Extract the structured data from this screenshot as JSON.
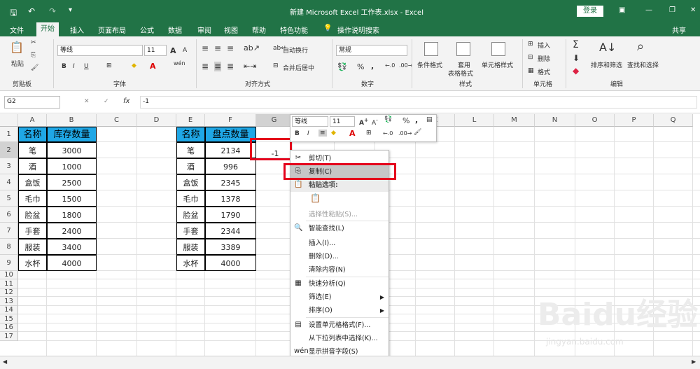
{
  "window": {
    "title": "新建 Microsoft Excel 工作表.xlsx - Excel",
    "login": "登录"
  },
  "tabs": [
    "文件",
    "开始",
    "插入",
    "页面布局",
    "公式",
    "数据",
    "审阅",
    "视图",
    "帮助",
    "特色功能",
    "操作说明搜索",
    "共享"
  ],
  "active_tab": "开始",
  "ribbon": {
    "clipboard": {
      "paste": "粘贴",
      "group": "剪贴板"
    },
    "font": {
      "name": "等线",
      "size": "11",
      "grow": "A",
      "shrink": "A",
      "bold": "B",
      "italic": "I",
      "underline": "U",
      "phonetic": "wén",
      "group": "字体"
    },
    "align": {
      "wrap": "自动换行",
      "merge": "合并后居中",
      "group": "对齐方式"
    },
    "number": {
      "format": "常规",
      "percent": "%",
      "comma": ",",
      "group": "数字"
    },
    "styles": {
      "cond": "条件格式",
      "table1": "套用",
      "table2": "表格格式",
      "cellstyle": "单元格样式",
      "group": "样式"
    },
    "cells": {
      "insert": "插入",
      "delete": "删除",
      "format": "格式",
      "group": "单元格"
    },
    "editing": {
      "sortfilter": "排序和筛选",
      "findselect": "查找和选择",
      "group": "编辑"
    }
  },
  "formula_bar": {
    "namebox": "G2",
    "cancel": "✕",
    "enter": "✓",
    "fx": "fx",
    "value": "-1"
  },
  "columns": [
    "A",
    "B",
    "C",
    "D",
    "E",
    "F",
    "G",
    "H",
    "I",
    "J",
    "K",
    "L",
    "M",
    "N",
    "O",
    "P",
    "Q"
  ],
  "rows": [
    "1",
    "2",
    "3",
    "4",
    "5",
    "6",
    "7",
    "8",
    "9",
    "10",
    "11",
    "12",
    "13",
    "14",
    "15",
    "16",
    "17"
  ],
  "table1": {
    "headers": [
      "名称",
      "库存数量"
    ],
    "rows": [
      [
        "笔",
        "3000"
      ],
      [
        "酒",
        "1000"
      ],
      [
        "盒饭",
        "2500"
      ],
      [
        "毛巾",
        "1500"
      ],
      [
        "脸盆",
        "1800"
      ],
      [
        "手套",
        "2400"
      ],
      [
        "服装",
        "3400"
      ],
      [
        "水杯",
        "4000"
      ]
    ]
  },
  "table2": {
    "headers": [
      "名称",
      "盘点数量"
    ],
    "rows": [
      [
        "笔",
        "2134"
      ],
      [
        "酒",
        "996"
      ],
      [
        "盒饭",
        "2345"
      ],
      [
        "毛巾",
        "1378"
      ],
      [
        "脸盆",
        "1790"
      ],
      [
        "手套",
        "2344"
      ],
      [
        "服装",
        "3389"
      ],
      [
        "水杯",
        "4000"
      ]
    ]
  },
  "g2_value": "-1",
  "mini_toolbar": {
    "font": "等线",
    "size": "11",
    "bold": "B",
    "italic": "I",
    "percent": "%",
    "comma": ","
  },
  "context_menu": [
    {
      "label": "剪切(T)",
      "icon": "✂",
      "enabled": true
    },
    {
      "label": "复制(C)",
      "icon": "⎘",
      "enabled": true,
      "highlight": true
    },
    {
      "label": "粘贴选项:",
      "icon": "📋",
      "enabled": true,
      "header": true
    },
    {
      "label": "",
      "icon": "📋",
      "enabled": false
    },
    {
      "label": "选择性粘贴(S)...",
      "icon": "",
      "enabled": false
    },
    {
      "label": "智能查找(L)",
      "icon": "🔍",
      "enabled": true
    },
    {
      "label": "插入(I)...",
      "icon": "",
      "enabled": true
    },
    {
      "label": "删除(D)...",
      "icon": "",
      "enabled": true
    },
    {
      "label": "清除内容(N)",
      "icon": "",
      "enabled": true
    },
    {
      "label": "快速分析(Q)",
      "icon": "▦",
      "enabled": true
    },
    {
      "label": "筛选(E)",
      "icon": "",
      "enabled": true,
      "submenu": true
    },
    {
      "label": "排序(O)",
      "icon": "",
      "enabled": true,
      "submenu": true
    },
    {
      "label": "设置单元格格式(F)...",
      "icon": "▤",
      "enabled": true
    },
    {
      "label": "从下拉列表中选择(K)...",
      "icon": "",
      "enabled": true
    },
    {
      "label": "显示拼音字段(S)",
      "icon": "wén",
      "enabled": true
    }
  ],
  "watermark": {
    "brand": "Baidu",
    "text": "经验",
    "url": "jingyan.baidu.com"
  },
  "colors": {
    "excel_green": "#217346",
    "header_blue": "#1fa7e6",
    "highlight_red": "#e4001b"
  }
}
